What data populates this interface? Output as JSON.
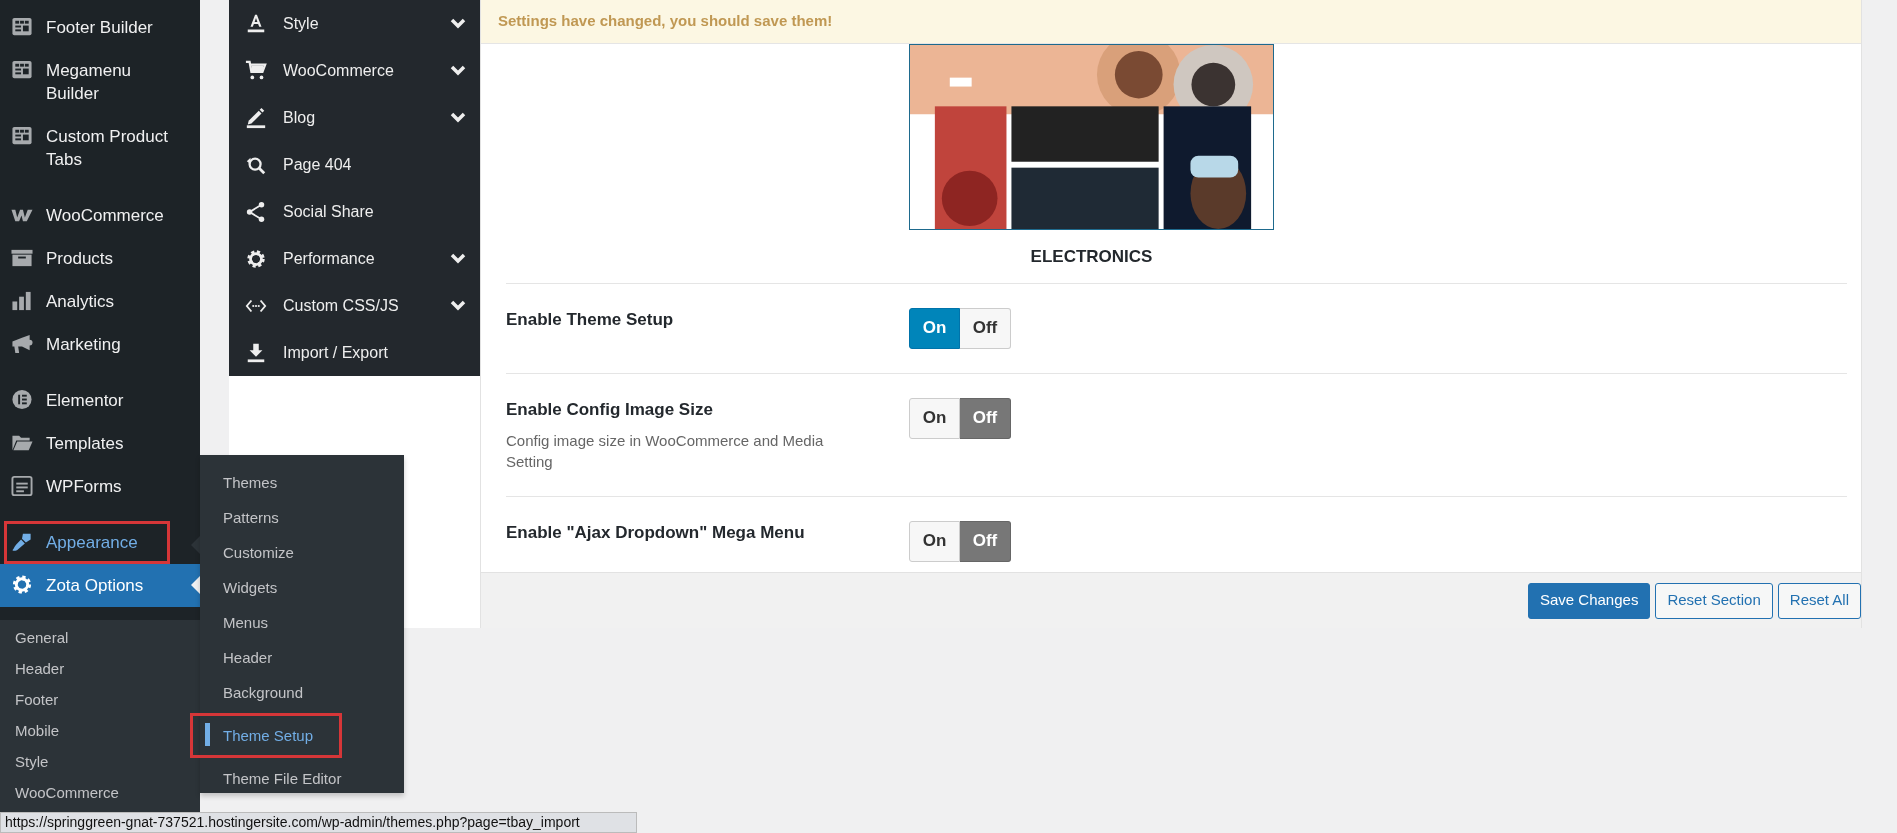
{
  "admin_menu": {
    "groups": [
      {
        "items": [
          {
            "label": "Footer Builder",
            "current": false,
            "hovered": false,
            "outlined": false
          },
          {
            "label": "Megamenu Builder",
            "current": false,
            "hovered": false,
            "outlined": false
          },
          {
            "label": "Custom Product Tabs",
            "current": false,
            "hovered": false,
            "outlined": false
          }
        ]
      },
      {
        "items": [
          {
            "label": "WooCommerce",
            "current": false,
            "hovered": false,
            "outlined": false
          },
          {
            "label": "Products",
            "current": false,
            "hovered": false,
            "outlined": false
          },
          {
            "label": "Analytics",
            "current": false,
            "hovered": false,
            "outlined": false
          },
          {
            "label": "Marketing",
            "current": false,
            "hovered": false,
            "outlined": false
          }
        ]
      },
      {
        "items": [
          {
            "label": "Elementor",
            "current": false,
            "hovered": false,
            "outlined": false
          },
          {
            "label": "Templates",
            "current": false,
            "hovered": false,
            "outlined": false
          },
          {
            "label": "WPForms",
            "current": false,
            "hovered": false,
            "outlined": false
          }
        ]
      },
      {
        "items": [
          {
            "label": "Appearance",
            "current": false,
            "hovered": true,
            "outlined": true
          },
          {
            "label": "Zota Options",
            "current": true,
            "hovered": false,
            "outlined": false
          }
        ]
      }
    ],
    "submenu": [
      {
        "label": "General"
      },
      {
        "label": "Header"
      },
      {
        "label": "Footer"
      },
      {
        "label": "Mobile"
      },
      {
        "label": "Style"
      },
      {
        "label": "WooCommerce"
      }
    ]
  },
  "flyout": {
    "items": [
      {
        "label": "Themes",
        "selected": false,
        "outlined": false
      },
      {
        "label": "Patterns",
        "selected": false,
        "outlined": false
      },
      {
        "label": "Customize",
        "selected": false,
        "outlined": false
      },
      {
        "label": "Widgets",
        "selected": false,
        "outlined": false
      },
      {
        "label": "Menus",
        "selected": false,
        "outlined": false
      },
      {
        "label": "Header",
        "selected": false,
        "outlined": false
      },
      {
        "label": "Background",
        "selected": false,
        "outlined": false
      },
      {
        "label": "Theme Setup",
        "selected": true,
        "outlined": true
      },
      {
        "label": "Theme File Editor",
        "selected": false,
        "outlined": false
      }
    ]
  },
  "options_menu": {
    "items": [
      {
        "label": "Style",
        "expandable": true
      },
      {
        "label": "WooCommerce",
        "expandable": true
      },
      {
        "label": "Blog",
        "expandable": true
      },
      {
        "label": "Page 404",
        "expandable": false
      },
      {
        "label": "Social Share",
        "expandable": false
      },
      {
        "label": "Performance",
        "expandable": true
      },
      {
        "label": "Custom CSS/JS",
        "expandable": true
      },
      {
        "label": "Import / Export",
        "expandable": false
      }
    ]
  },
  "notice": "Settings have changed, you should save them!",
  "preset": {
    "kind": "picture",
    "caption": "ELECTRONICS"
  },
  "settings": [
    {
      "label": "Enable Theme Setup",
      "on": true,
      "on_label": "On",
      "off_label": "Off"
    },
    {
      "label": "Enable Config Image Size",
      "description": "Config image size in WooCommerce and Media Setting",
      "on": false,
      "on_label": "On",
      "off_label": "Off"
    },
    {
      "label": "Enable \"Ajax Dropdown\" Mega Menu",
      "on": false,
      "on_label": "On",
      "off_label": "Off"
    }
  ],
  "buttons": [
    {
      "label": "Save Changes",
      "kind": "primary"
    },
    {
      "label": "Reset Section",
      "kind": "secondary"
    },
    {
      "label": "Reset All",
      "kind": "secondary"
    }
  ],
  "status_bar": {
    "url": "https://springgreen-gnat-737521.hostingersite.com/wp-admin/themes.php?page=tbay_import"
  }
}
